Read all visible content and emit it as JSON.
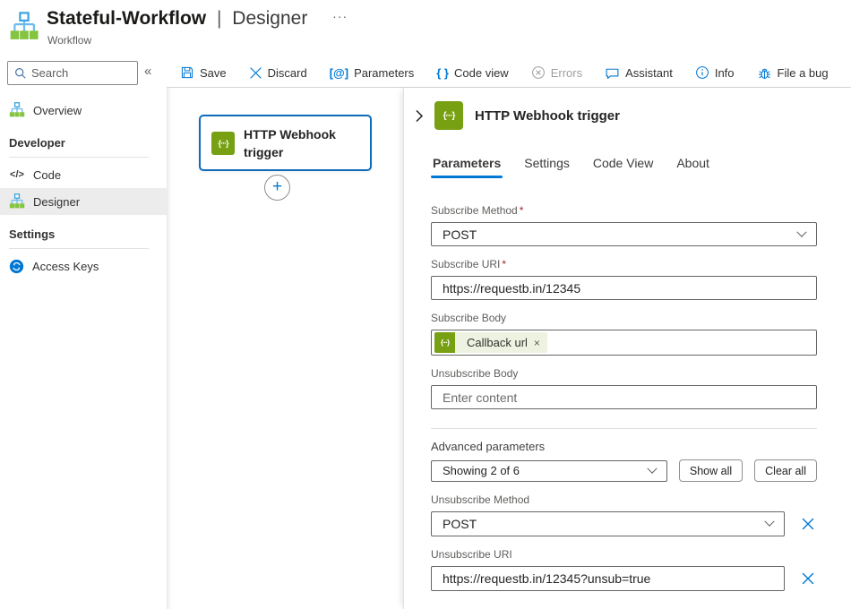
{
  "colors": {
    "accent": "#0078d4",
    "node_selected_border": "#0f6cbd",
    "webhook_green": "#77a012",
    "token_chip_bg": "#edf3e0",
    "required_red": "#a4262c",
    "disabled_gray": "#a19f9d"
  },
  "header": {
    "title": "Stateful-Workflow",
    "separator": "|",
    "view": "Designer",
    "more": "···",
    "subtitle": "Workflow"
  },
  "search": {
    "placeholder": "Search",
    "collapse": "«"
  },
  "toolbar": {
    "save": "Save",
    "discard": "Discard",
    "parameters": "Parameters",
    "parameters_glyph": "[@]",
    "code_view": "Code view",
    "code_view_glyph": "{ }",
    "errors": "Errors",
    "assistant": "Assistant",
    "info": "Info",
    "file_a_bug": "File a bug"
  },
  "sidebar": {
    "overview": "Overview",
    "developer_section": "Developer",
    "code": "Code",
    "code_glyph": "</>",
    "designer": "Designer",
    "settings_section": "Settings",
    "access_keys": "Access Keys"
  },
  "canvas": {
    "node_title": "HTTP Webhook trigger",
    "node_glyph": "{···}",
    "add_label": "+"
  },
  "panel": {
    "title": "HTTP Webhook trigger",
    "icon_glyph": "{···}",
    "tabs": [
      "Parameters",
      "Settings",
      "Code View",
      "About"
    ],
    "active_tab": "Parameters",
    "subscribe_method": {
      "label": "Subscribe Method",
      "required": "*",
      "value": "POST"
    },
    "subscribe_uri": {
      "label": "Subscribe URI",
      "required": "*",
      "value": "https://requestb.in/12345"
    },
    "subscribe_body": {
      "label": "Subscribe Body",
      "token_glyph": "{···}",
      "token": "Callback url",
      "remove": "×"
    },
    "unsubscribe_body": {
      "label": "Unsubscribe Body",
      "placeholder": "Enter content"
    },
    "advanced": {
      "label": "Advanced parameters",
      "value": "Showing 2 of 6",
      "show_all": "Show all",
      "clear_all": "Clear all"
    },
    "unsubscribe_method": {
      "label": "Unsubscribe Method",
      "value": "POST"
    },
    "unsubscribe_uri": {
      "label": "Unsubscribe URI",
      "value": "https://requestb.in/12345?unsub=true"
    }
  }
}
